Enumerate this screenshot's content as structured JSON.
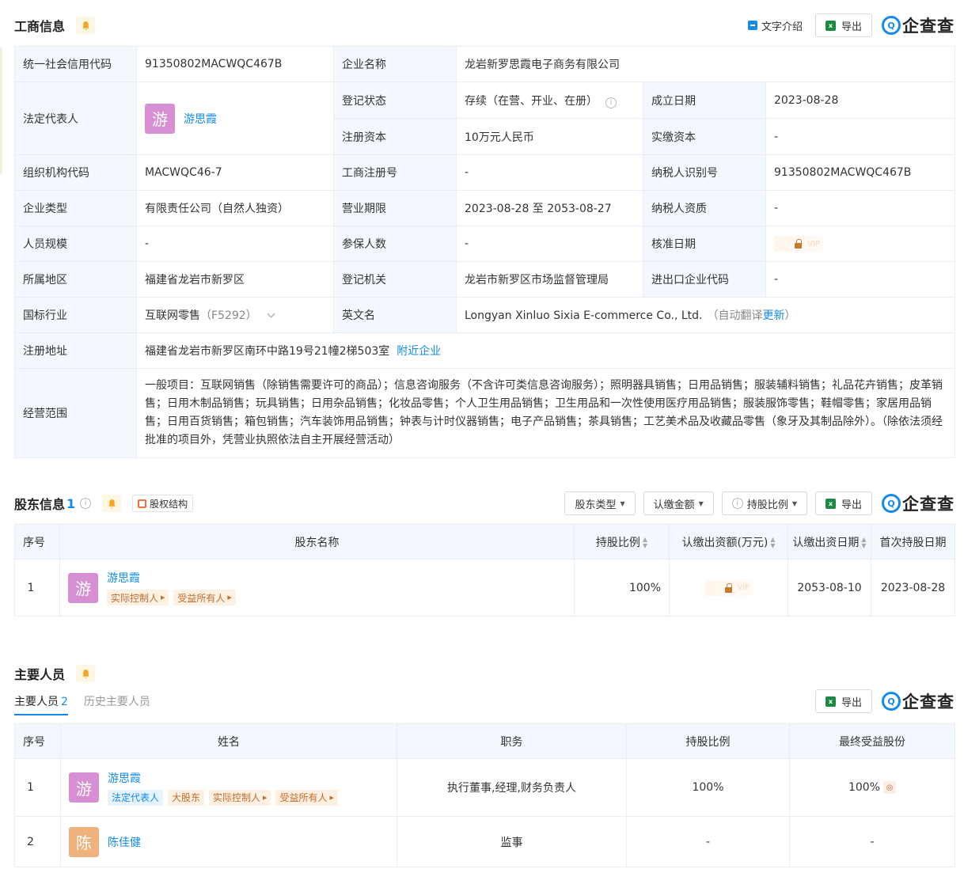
{
  "biz": {
    "title": "工商信息",
    "text_intro": "文字介绍",
    "export": "导出",
    "logo_text": "企查查",
    "rows": {
      "credit_code_label": "统一社会信用代码",
      "credit_code": "91350802MACWQC467B",
      "company_name_label": "企业名称",
      "company_name": "龙岩新罗思霞电子商务有限公司",
      "legal_rep_label": "法定代表人",
      "legal_rep_avatar": "游",
      "legal_rep": "游思霞",
      "reg_status_label": "登记状态",
      "reg_status": "存续（在营、开业、在册）",
      "found_date_label": "成立日期",
      "found_date": "2023-08-28",
      "reg_capital_label": "注册资本",
      "reg_capital": "10万元人民币",
      "paid_capital_label": "实缴资本",
      "paid_capital": "-",
      "org_code_label": "组织机构代码",
      "org_code": "MACWQC46-7",
      "biz_reg_no_label": "工商注册号",
      "biz_reg_no": "-",
      "taxpayer_id_label": "纳税人识别号",
      "taxpayer_id": "91350802MACWQC467B",
      "company_type_label": "企业类型",
      "company_type": "有限责任公司（自然人独资）",
      "biz_term_label": "营业期限",
      "biz_term": "2023-08-28 至 2053-08-27",
      "taxpayer_qual_label": "纳税人资质",
      "taxpayer_qual": "-",
      "staff_size_label": "人员规模",
      "staff_size": "-",
      "insured_label": "参保人数",
      "insured": "-",
      "approve_date_label": "核准日期",
      "approve_lock": "VIP",
      "region_label": "所属地区",
      "region": "福建省龙岩市新罗区",
      "reg_authority_label": "登记机关",
      "reg_authority": "龙岩市新罗区市场监督管理局",
      "ie_code_label": "进出口企业代码",
      "ie_code": "-",
      "industry_label": "国标行业",
      "industry": "互联网零售",
      "industry_code": "（F5292）",
      "en_name_label": "英文名",
      "en_name": "Longyan Xinluo Sixia E-commerce Co., Ltd.",
      "en_name_note_pre": "（自动翻译",
      "en_name_update": "更新",
      "en_name_note_post": "）",
      "address_label": "注册地址",
      "address": "福建省龙岩市新罗区南环中路19号21幢2梯503室",
      "nearby": "附近企业",
      "scope_label": "经营范围",
      "scope": "一般项目：互联网销售（除销售需要许可的商品）；信息咨询服务（不含许可类信息咨询服务）；照明器具销售；日用品销售；服装辅料销售；礼品花卉销售；皮革销售；日用木制品销售；玩具销售；日用杂品销售；化妆品零售；个人卫生用品销售；卫生用品和一次性使用医疗用品销售；服装服饰零售；鞋帽零售；家居用品销售；日用百货销售；箱包销售；汽车装饰用品销售；钟表与计时仪器销售；电子产品销售；茶具销售；工艺美术品及收藏品零售（象牙及其制品除外）。（除依法须经批准的项目外，凭营业执照依法自主开展经营活动）"
    }
  },
  "holders": {
    "title": "股东信息",
    "count": "1",
    "equity_chip": "股权结构",
    "filter_type": "股东类型",
    "filter_amount": "认缴金额",
    "filter_ratio": "持股比例",
    "export": "导出",
    "logo_text": "企查查",
    "headers": {
      "no": "序号",
      "name": "股东名称",
      "ratio": "持股比例",
      "sub_amount": "认缴出资额(万元)",
      "sub_date": "认缴出资日期",
      "first_date": "首次持股日期"
    },
    "rows": [
      {
        "no": "1",
        "avatar": "游",
        "name": "游思霞",
        "tag1": "实际控制人",
        "tag2": "受益所有人",
        "ratio": "100%",
        "lock": "VIP",
        "sub_date": "2053-08-10",
        "first_date": "2023-08-28"
      }
    ]
  },
  "people": {
    "title": "主要人员",
    "tab_main": "主要人员",
    "tab_main_count": "2",
    "tab_history": "历史主要人员",
    "export": "导出",
    "logo_text": "企查查",
    "headers": {
      "no": "序号",
      "name": "姓名",
      "role": "职务",
      "ratio": "持股比例",
      "benefit": "最终受益股份"
    },
    "rows": [
      {
        "no": "1",
        "avatar": "游",
        "name": "游思霞",
        "tag1": "法定代表人",
        "tag2": "大股东",
        "tag3": "实际控制人",
        "tag4": "受益所有人",
        "role": "执行董事,经理,财务负责人",
        "ratio": "100%",
        "benefit": "100%"
      },
      {
        "no": "2",
        "avatar": "陈",
        "name": "陈佳健",
        "role": "监事",
        "ratio": "-",
        "benefit": "-"
      }
    ]
  }
}
